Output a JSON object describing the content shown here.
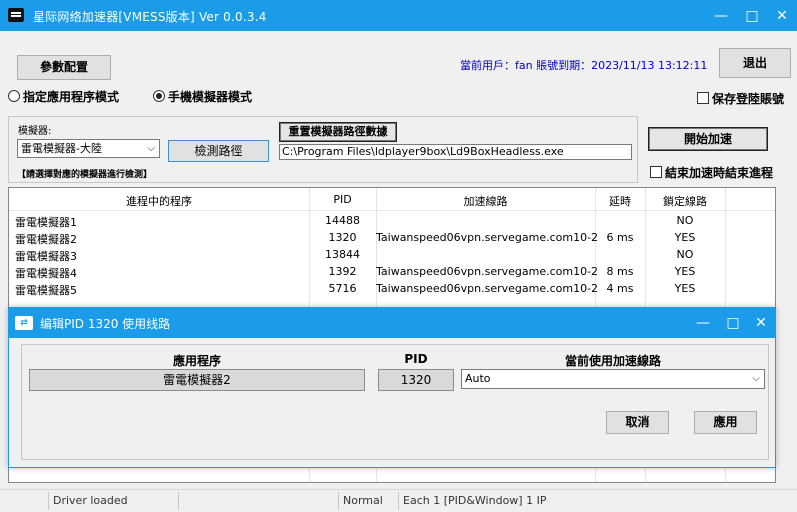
{
  "window": {
    "title": "星际网络加速器[VMESS版本] Ver 0.0.3.4",
    "minimize": "—",
    "maximize": "□",
    "close": "✕"
  },
  "toolbar": {
    "config_button": "參數配置",
    "user_info": "當前用戶：fan 賬號到期：2023/11/13 13:12:11",
    "exit_button": "退出"
  },
  "mode": {
    "specified_app_label": "指定應用程序模式",
    "emulator_label": "手機模擬器模式",
    "selected": "手機模擬器模式",
    "save_login_label": "保存登陸賬號"
  },
  "emulator": {
    "label": "模擬器:",
    "selected": "雷電模擬器-大陸",
    "detect_button": "檢測路徑",
    "reset_path_button": "重置模擬器路徑數據",
    "path_value": "C:\\Program Files\\ldplayer9box\\Ld9BoxHeadless.exe",
    "hint": "【請選擇對應的模擬器進行檢測】"
  },
  "actions": {
    "start_button": "開始加速",
    "end_process_label": "結束加速時結束進程"
  },
  "process_table": {
    "columns": [
      "進程中的程序",
      "PID",
      "加速線路",
      "延時",
      "鎖定線路"
    ],
    "rows": [
      [
        "雷電模擬器1",
        "14488",
        "",
        "",
        "NO"
      ],
      [
        "雷電模擬器2",
        "1320",
        "Taiwanspeed06vpn.servegame.com10-2",
        "6 ms",
        "YES"
      ],
      [
        "雷電模擬器3",
        "13844",
        "",
        "",
        "NO"
      ],
      [
        "雷電模擬器4",
        "1392",
        "Taiwanspeed06vpn.servegame.com10-2",
        "8 ms",
        "YES"
      ],
      [
        "雷電模擬器5",
        "5716",
        "Taiwanspeed06vpn.servegame.com10-2",
        "4 ms",
        "YES"
      ]
    ]
  },
  "dialog": {
    "title": "编辑PID 1320 使用线路",
    "app_header": "應用程序",
    "pid_header": "PID",
    "line_header": "當前使用加速線路",
    "app_value": "雷電模擬器2",
    "pid_value": "1320",
    "line_value": "Auto",
    "cancel_button": "取消",
    "apply_button": "應用"
  },
  "statusbar": {
    "driver": "Driver loaded",
    "mode": "Normal",
    "info": "Each 1 [PID&Window] 1 IP"
  },
  "colors": {
    "titlebar": "#1a9ce8",
    "user_info": "#0000cc"
  }
}
